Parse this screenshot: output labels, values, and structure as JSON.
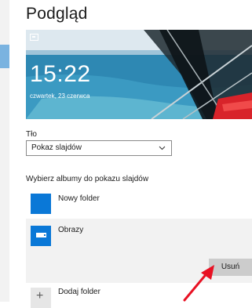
{
  "header": {
    "title": "Podgląd"
  },
  "preview": {
    "time": "15:22",
    "date": "czwartek, 23 czerwca"
  },
  "background": {
    "label": "Tło",
    "selected": "Pokaz slajdów"
  },
  "albums": {
    "label": "Wybierz albumy do pokazu slajdów",
    "items": [
      {
        "name": "Nowy folder"
      },
      {
        "name": "Obrazy"
      }
    ],
    "remove_label": "Usuń",
    "add_label": "Dodaj folder"
  },
  "colors": {
    "accent": "#0a78d7",
    "annotation": "#e81123"
  },
  "icons": {
    "slideshow": "slideshow-icon",
    "dropdown": "chevron-down-icon",
    "folder": "folder-icon",
    "add": "plus-icon",
    "annotation": "red-arrow"
  }
}
